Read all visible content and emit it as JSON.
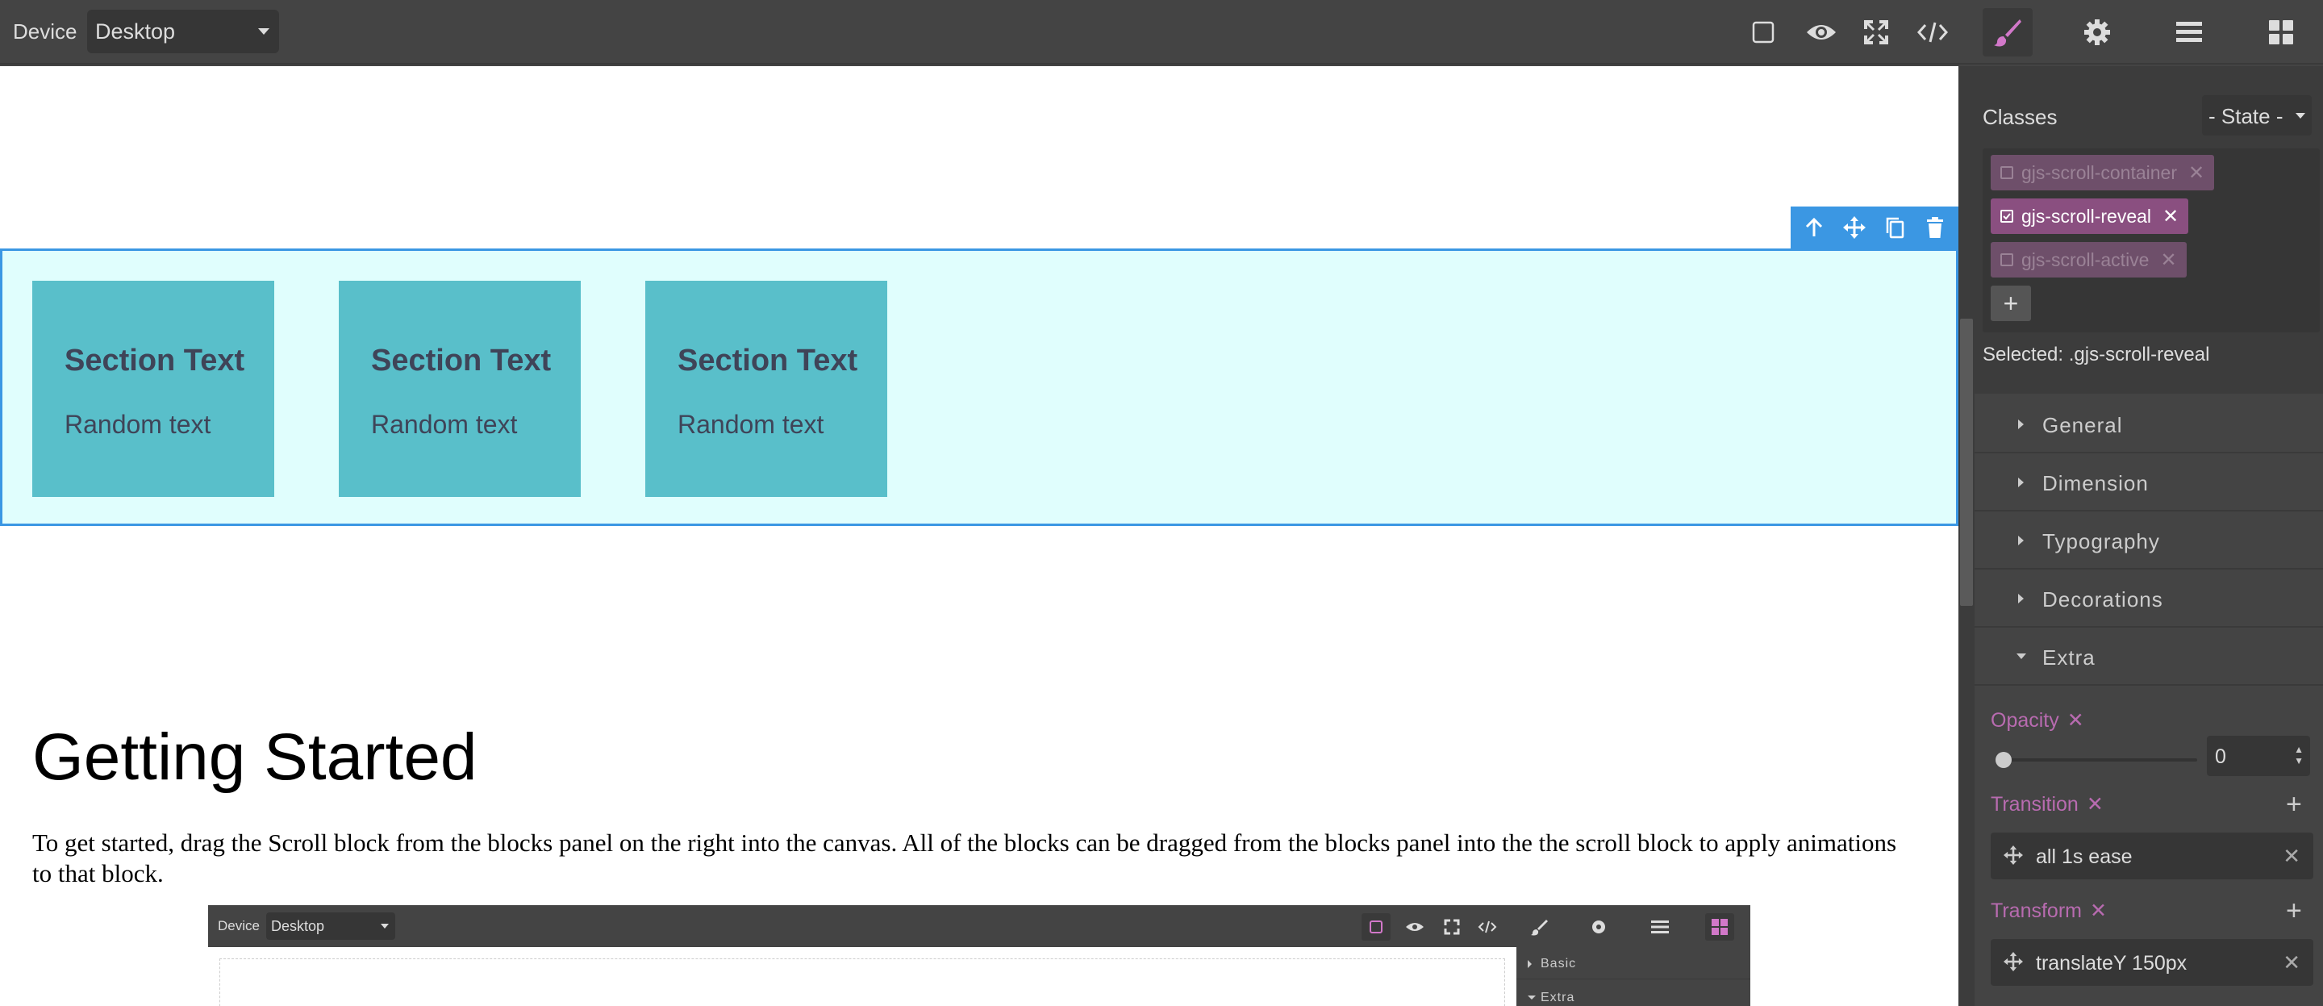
{
  "topbar": {
    "device_label": "Device",
    "device_value": "Desktop",
    "icons": [
      "square-outline-icon",
      "eye-icon",
      "fullscreen-icon",
      "code-icon",
      "paintbrush-icon",
      "gear-icon",
      "layers-icon",
      "blocks-icon"
    ],
    "accent_color": "#d278c9"
  },
  "canvas": {
    "section": {
      "cards": [
        {
          "title": "Section Text",
          "text": "Random text"
        },
        {
          "title": "Section Text",
          "text": "Random text"
        },
        {
          "title": "Section Text",
          "text": "Random text"
        }
      ]
    },
    "heading": "Getting Started",
    "paragraph": "To get started, drag the Scroll block from the blocks panel on the right into the canvas. All of the blocks can be dragged from the blocks panel into the the scroll block to apply animations to that block.",
    "embedded": {
      "device_label": "Device",
      "device_value": "Desktop",
      "panel_rows": [
        "Basic",
        "Extra"
      ]
    }
  },
  "panel": {
    "classes_label": "Classes",
    "state_value": "- State -",
    "tags": [
      {
        "name": "gjs-scroll-container",
        "checked": false
      },
      {
        "name": "gjs-scroll-reveal",
        "checked": true
      },
      {
        "name": "gjs-scroll-active",
        "checked": false
      }
    ],
    "add_label": "+",
    "selected_text": "Selected: .gjs-scroll-reveal",
    "sectors": [
      "General",
      "Dimension",
      "Typography",
      "Decorations",
      "Extra"
    ],
    "opacity": {
      "label": "Opacity",
      "value": "0"
    },
    "transition": {
      "label": "Transition",
      "layer": "all 1s ease"
    },
    "transform": {
      "label": "Transform",
      "layer": "translateY 150px"
    }
  }
}
